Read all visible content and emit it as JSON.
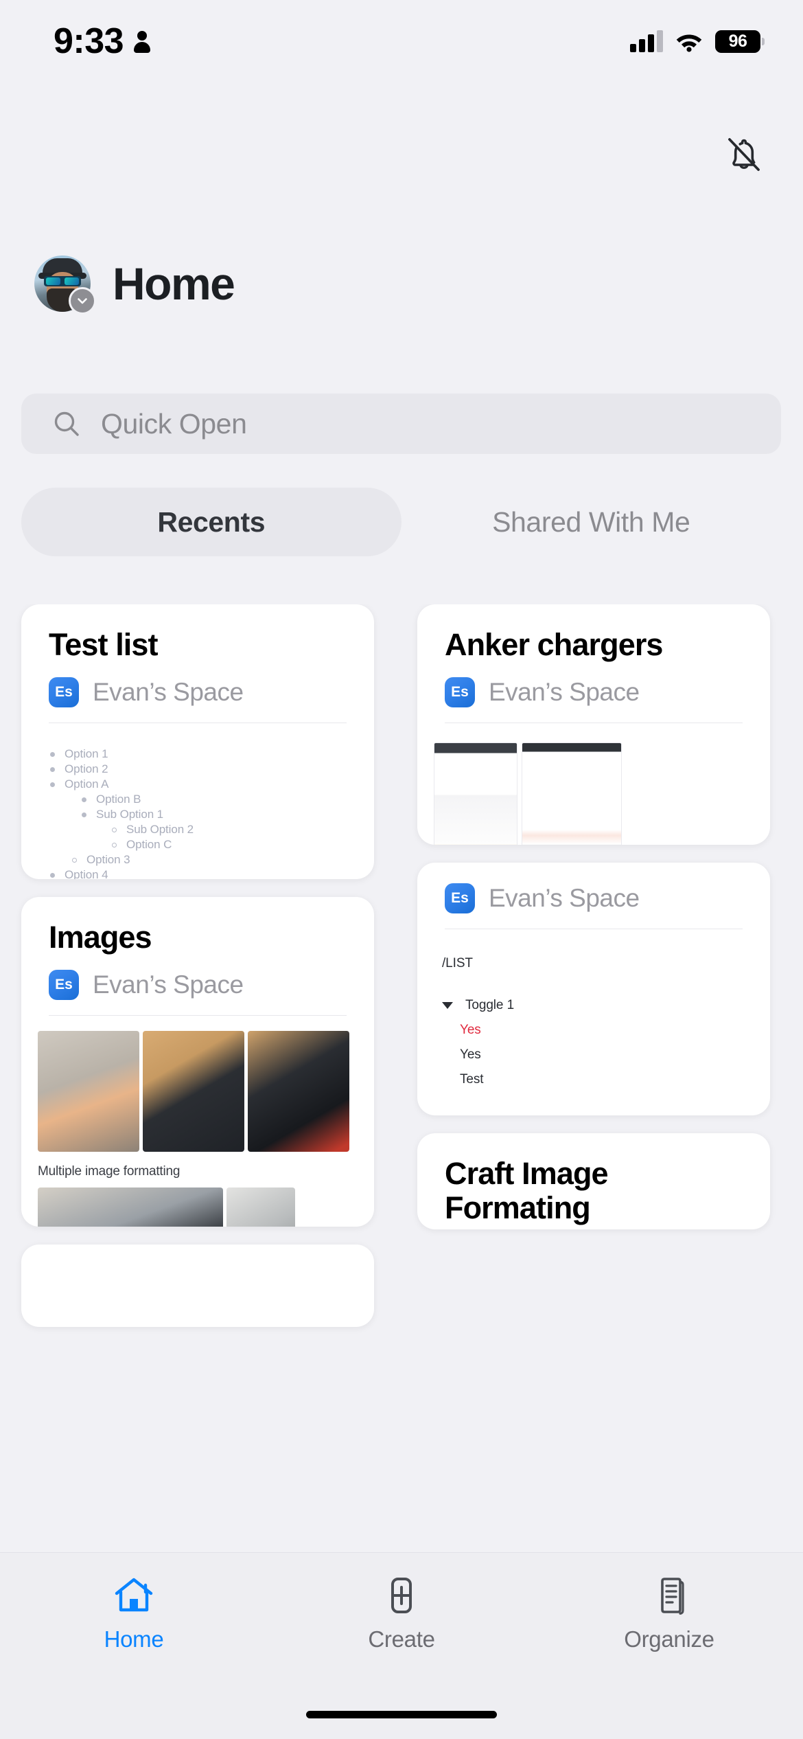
{
  "status_bar": {
    "time": "9:33",
    "person_icon": "person-icon",
    "signal_icon": "cellular-signal-icon",
    "wifi_icon": "wifi-icon",
    "battery_level": "96"
  },
  "header": {
    "notification_icon": "bell-slash-icon",
    "avatar_icon": "user-avatar",
    "avatar_chevron_icon": "chevron-down-icon",
    "title": "Home"
  },
  "search": {
    "icon": "search-icon",
    "placeholder": "Quick Open",
    "value": ""
  },
  "tabs": [
    {
      "label": "Recents",
      "active": true
    },
    {
      "label": "Shared With Me",
      "active": false
    }
  ],
  "cards": {
    "test_list": {
      "title": "Test list",
      "space_badge": "Es",
      "space_name": "Evan’s Space",
      "preview_items": [
        {
          "text": "Option 1",
          "indent": 0,
          "marker": "solid"
        },
        {
          "text": "Option 2",
          "indent": 0,
          "marker": "solid"
        },
        {
          "text": "Option A",
          "indent": 0,
          "marker": "solid"
        },
        {
          "text": "Option B",
          "indent": 1,
          "marker": "solid"
        },
        {
          "text": "Sub Option 1",
          "indent": 1,
          "marker": "solid"
        },
        {
          "text": "Sub Option 2",
          "indent": 2,
          "marker": "hollow"
        },
        {
          "text": "Option C",
          "indent": 2,
          "marker": "hollow"
        },
        {
          "text": "Option 3",
          "indent": 1,
          "marker": "hollow"
        },
        {
          "text": "Option 4",
          "indent": 0,
          "marker": "solid"
        },
        {
          "text": "",
          "indent": 0,
          "marker": "dark"
        }
      ]
    },
    "anker_chargers": {
      "title": "Anker chargers",
      "space_badge": "Es",
      "space_name": "Evan’s Space",
      "thumbnails": [
        "web-screenshot-left",
        "web-screenshot-right"
      ]
    },
    "images": {
      "title": "Images",
      "space_badge": "Es",
      "space_name": "Evan’s Space",
      "row1": [
        "hand-with-seeds-photo",
        "memory-card-cases-photo",
        "memory-card-cases-open-photo"
      ],
      "caption": "Multiple image formatting",
      "row2": [
        "workbench-photo",
        "metal-parts-photo"
      ]
    },
    "toggle_note": {
      "space_badge": "Es",
      "space_name": "Evan’s Space",
      "slash_command": "/LIST",
      "toggle_icon": "triangle-down-icon",
      "toggle_label": "Toggle 1",
      "lines": [
        {
          "text": "Yes",
          "color": "#e02b3f"
        },
        {
          "text": "Yes",
          "color": "#2a2d33"
        },
        {
          "text": "Test",
          "color": "#2a2d33"
        }
      ]
    },
    "craft_image": {
      "title": "Craft Image Formating"
    }
  },
  "bottom_nav": [
    {
      "label": "Home",
      "icon": "home-icon",
      "active": true
    },
    {
      "label": "Create",
      "icon": "plus-box-icon",
      "active": false
    },
    {
      "label": "Organize",
      "icon": "documents-icon",
      "active": false
    }
  ],
  "colors": {
    "accent": "#0a84ff",
    "background": "#f1f1f5",
    "card": "#ffffff",
    "muted_text": "#9a9aa0",
    "red": "#e02b3f"
  }
}
